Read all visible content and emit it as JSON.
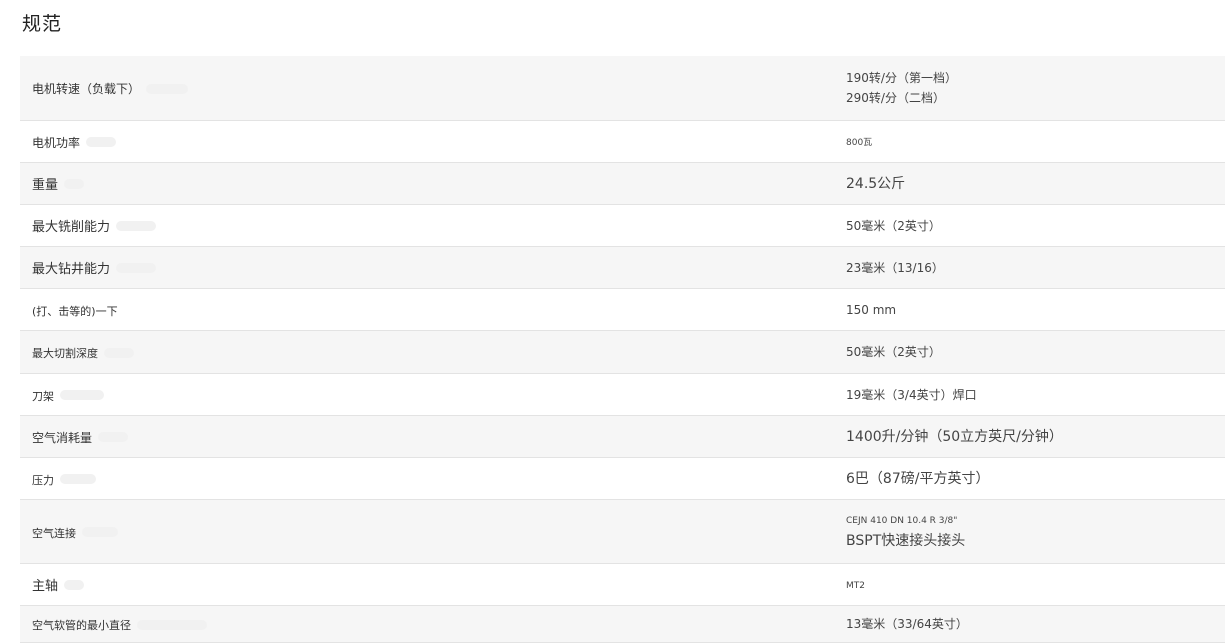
{
  "page": {
    "title": "规范"
  },
  "specs": [
    {
      "label": "电机转速（负载下）",
      "values": [
        "190转/分（第一档）",
        "290转/分（二档）"
      ]
    },
    {
      "label": "电机功率",
      "values": [
        "800瓦"
      ]
    },
    {
      "label": "重量",
      "values": [
        "24.5公斤"
      ]
    },
    {
      "label": "最大铣削能力",
      "values": [
        "50毫米（2英寸）"
      ]
    },
    {
      "label": "最大钻井能力",
      "values": [
        "23毫米（13/16）"
      ]
    },
    {
      "label": "(打、击等的)一下",
      "values": [
        "150 mm"
      ]
    },
    {
      "label": "最大切割深度",
      "values": [
        "50毫米（2英寸）"
      ]
    },
    {
      "label": "刀架",
      "values": [
        "19毫米（3/4英寸）焊口"
      ]
    },
    {
      "label": "空气消耗量",
      "values": [
        "1400升/分钟（50立方英尺/分钟）"
      ]
    },
    {
      "label": "压力",
      "values": [
        "6巴（87磅/平方英寸）"
      ]
    },
    {
      "label": "空气连接",
      "values": [
        "CEJN 410 DN 10.4 R 3/8\"",
        "BSPT快速接头接头"
      ]
    },
    {
      "label": "主轴",
      "values": [
        "MT2"
      ]
    },
    {
      "label": "空气软管的最小直径",
      "values": [
        "13毫米（33/64英寸）"
      ]
    }
  ]
}
